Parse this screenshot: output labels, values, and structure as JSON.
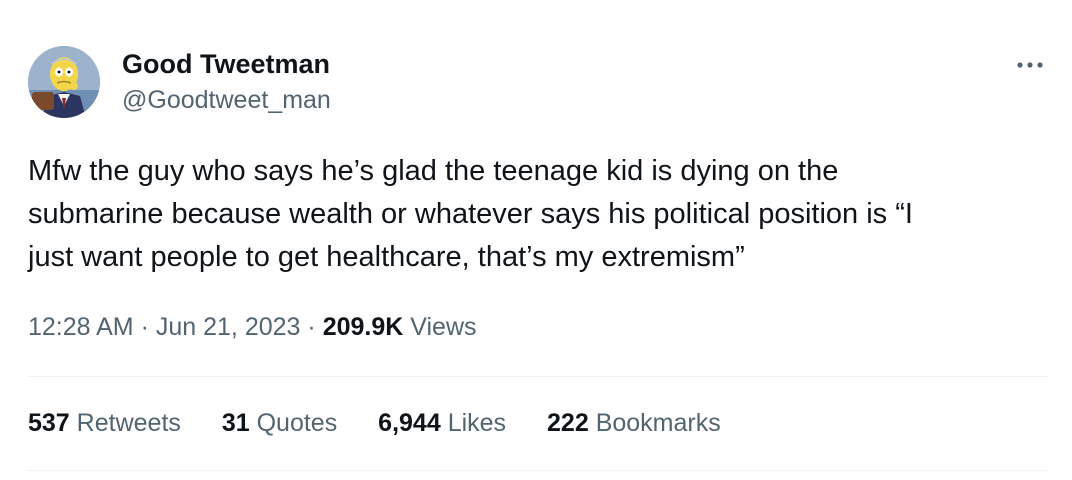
{
  "author": {
    "display_name": "Good Tweetman",
    "handle": "@Goodtweet_man",
    "avatar_icon": "cartoon-avatar-icon"
  },
  "menu": {
    "icon": "more-horizontal-icon"
  },
  "tweet": {
    "text": "Mfw the guy who says he’s glad the teenage kid is dying on the\nsubmarine because wealth or whatever says his political position is “I\njust want people to get healthcare, that’s my extremism”",
    "time": "12:28 AM",
    "separator": "·",
    "date": "Jun 21, 2023",
    "views_count": "209.9K",
    "views_label": "Views"
  },
  "stats": {
    "retweets": {
      "count": "537",
      "label": "Retweets"
    },
    "quotes": {
      "count": "31",
      "label": "Quotes"
    },
    "likes": {
      "count": "6,944",
      "label": "Likes"
    },
    "bookmarks": {
      "count": "222",
      "label": "Bookmarks"
    }
  },
  "colors": {
    "primary_text": "#0f1419",
    "secondary_text": "#536471",
    "divider": "#eff3f4",
    "background": "#ffffff"
  }
}
